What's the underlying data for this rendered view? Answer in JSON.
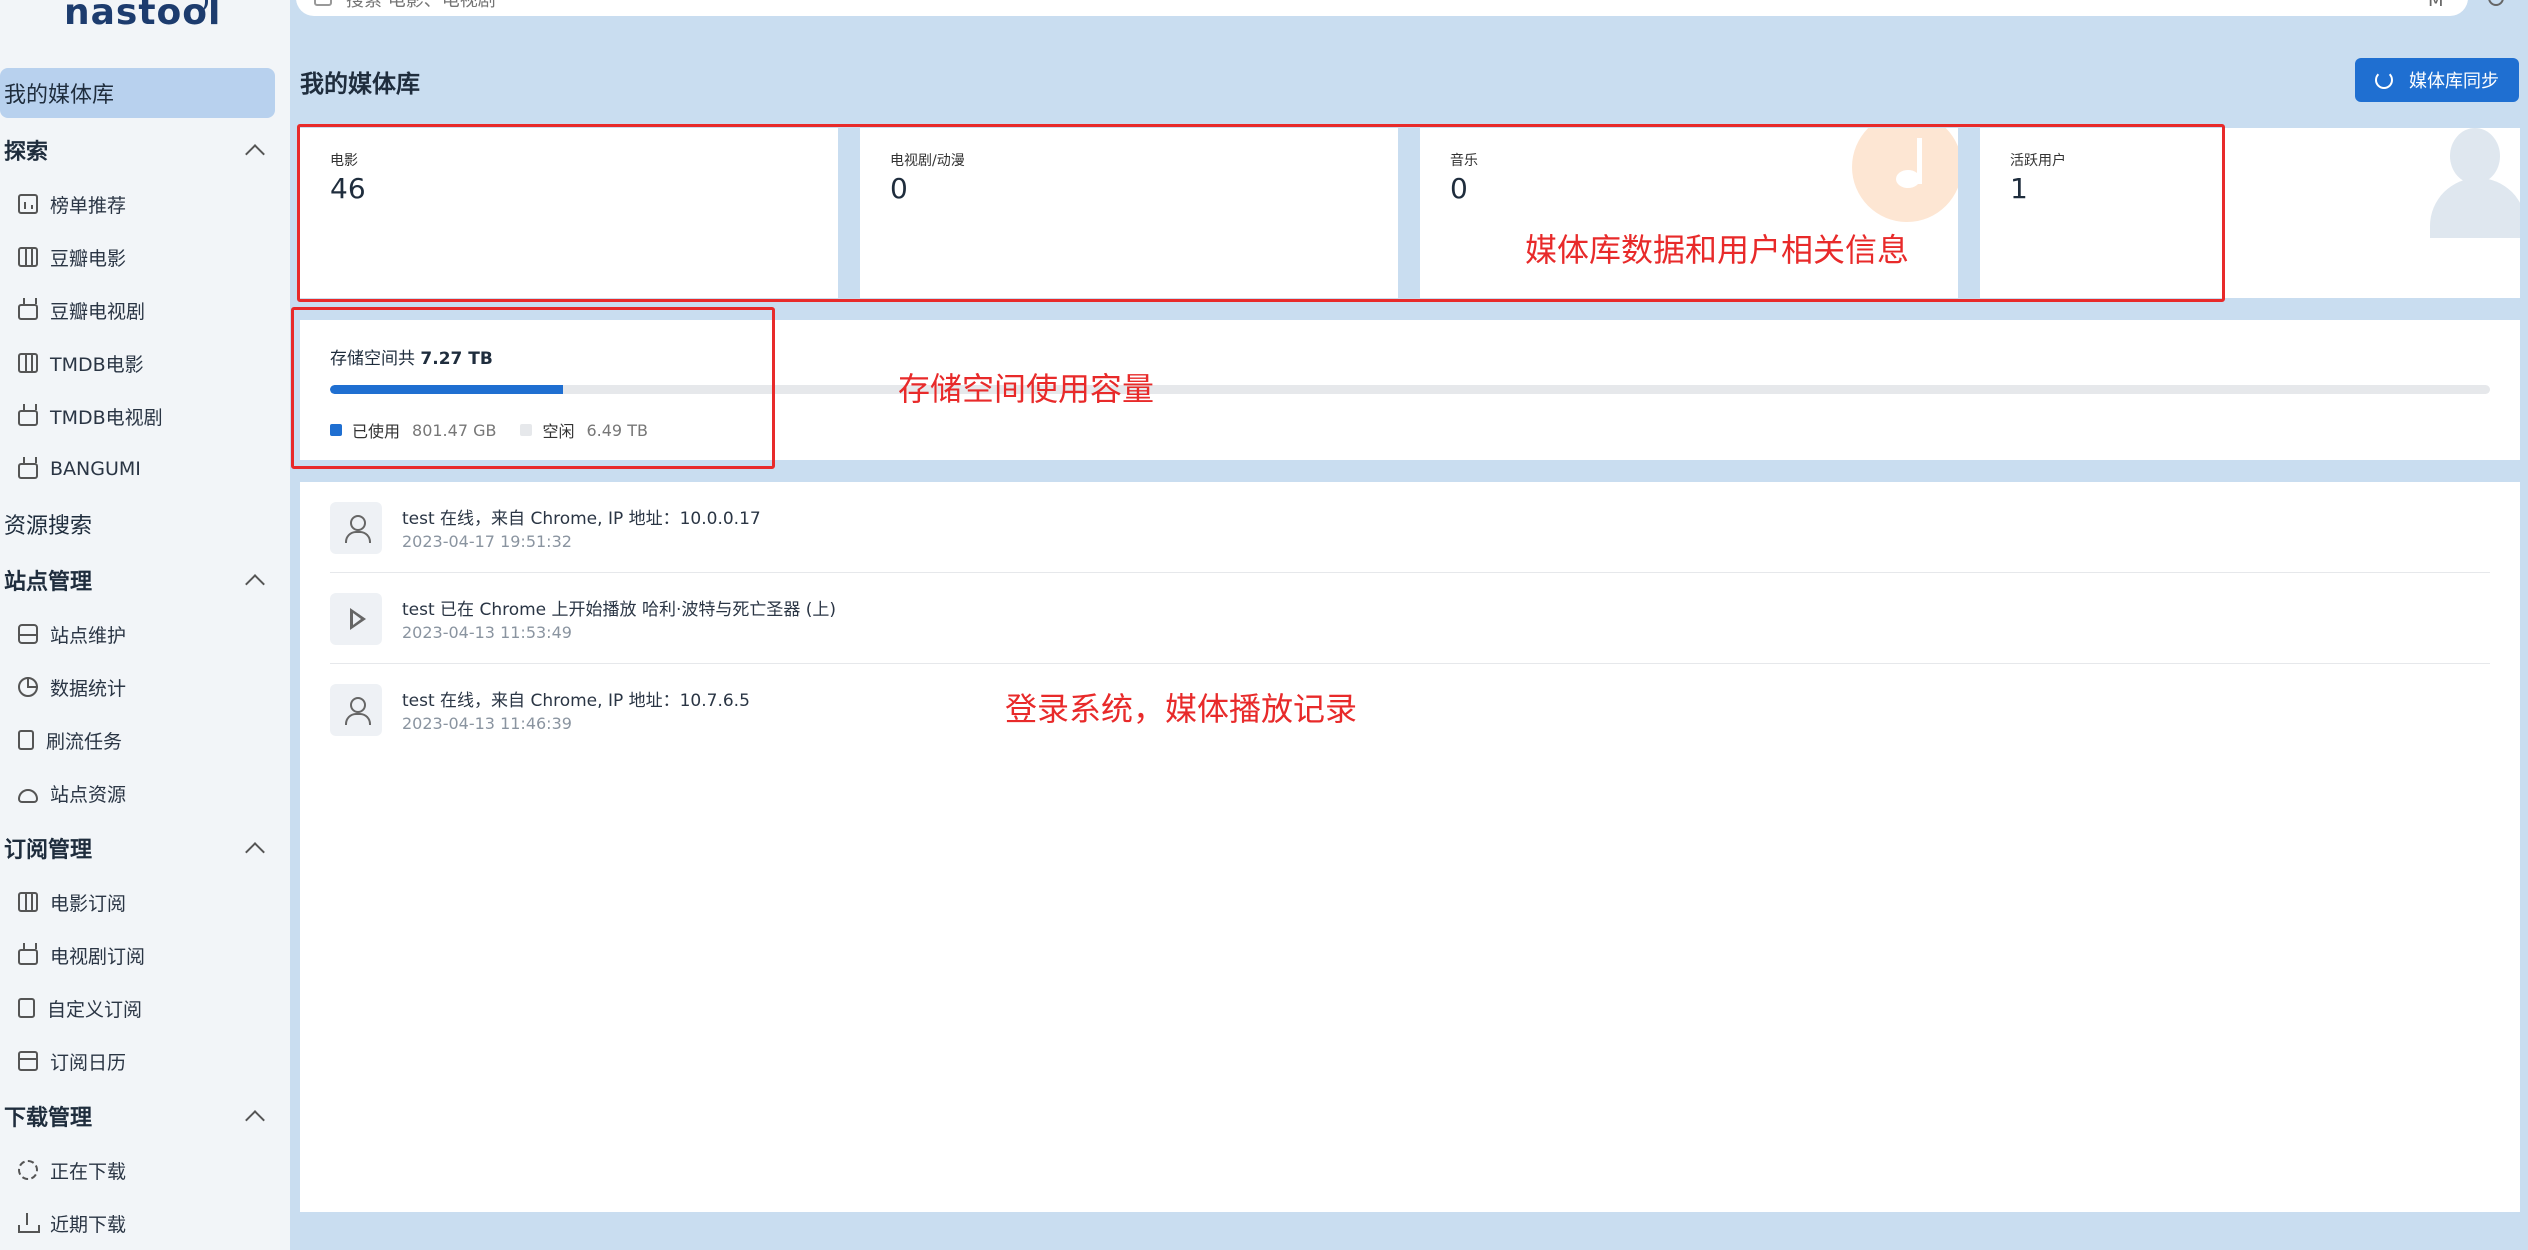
{
  "app": {
    "logo_text": "nastool"
  },
  "search": {
    "placeholder": "搜索 电影、电视剧",
    "top_right_text": "M"
  },
  "sidebar": {
    "active_item": "我的媒体库",
    "sections": {
      "explore": {
        "title": "探索",
        "items": [
          "榜单推荐",
          "豆瓣电影",
          "豆瓣电视剧",
          "TMDB电影",
          "TMDB电视剧",
          "BANGUMI"
        ]
      },
      "resource_search": "资源搜索",
      "site_mgmt": {
        "title": "站点管理",
        "items": [
          "站点维护",
          "数据统计",
          "刷流任务",
          "站点资源"
        ]
      },
      "subscription_mgmt": {
        "title": "订阅管理",
        "items": [
          "电影订阅",
          "电视剧订阅",
          "自定义订阅",
          "订阅日历"
        ]
      },
      "download_mgmt": {
        "title": "下载管理",
        "items": [
          "正在下载",
          "近期下载"
        ]
      }
    }
  },
  "page": {
    "title": "我的媒体库",
    "sync_button": "媒体库同步"
  },
  "stats": [
    {
      "label": "电影",
      "value": "46"
    },
    {
      "label": "电视剧/动漫",
      "value": "0"
    },
    {
      "label": "音乐",
      "value": "0"
    },
    {
      "label": "活跃用户",
      "value": "1"
    }
  ],
  "storage": {
    "title_prefix": "存储空间共",
    "total": "7.27 TB",
    "used_fraction": 0.108,
    "used_label": "已使用",
    "used_value": "801.47 GB",
    "free_label": "空闲",
    "free_value": "6.49 TB"
  },
  "activity": [
    {
      "icon": "user-icon",
      "text": "test 在线，来自 Chrome, IP 地址：10.0.0.17",
      "time": "2023-04-17 19:51:32"
    },
    {
      "icon": "play-icon",
      "text": "test 已在 Chrome 上开始播放 哈利·波特与死亡圣器 (上)",
      "time": "2023-04-13 11:53:49"
    },
    {
      "icon": "user-icon",
      "text": "test 在线，来自 Chrome, IP 地址：10.7.6.5",
      "time": "2023-04-13 11:46:39"
    }
  ],
  "annotations": {
    "stats": "媒体库数据和用户相关信息",
    "storage": "存储空间使用容量",
    "activity": "登录系统，媒体播放记录"
  },
  "colors": {
    "accent": "#1f6fd1",
    "annotation": "#e82a2a",
    "page_bg": "#c9ddf0",
    "storage_free": "#e6e8eb"
  }
}
